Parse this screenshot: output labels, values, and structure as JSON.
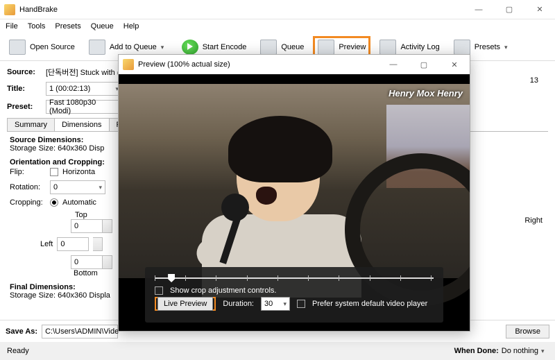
{
  "app": {
    "title": "HandBrake"
  },
  "menu": {
    "file": "File",
    "tools": "Tools",
    "presets": "Presets",
    "queue": "Queue",
    "help": "Help"
  },
  "toolbar": {
    "open": "Open Source",
    "add_queue": "Add to Queue",
    "start": "Start Encode",
    "queue": "Queue",
    "preview": "Preview",
    "activity": "Activity Log",
    "presets": "Presets"
  },
  "source": {
    "lbl": "Source:",
    "value": "[단독버전] Stuck with ("
  },
  "title_row": {
    "lbl": "Title:",
    "value": "1  (00:02:13)"
  },
  "right_labels": {
    "angle": "13"
  },
  "preset_row": {
    "lbl": "Preset:",
    "value": "Fast 1080p30  (Modi)"
  },
  "tabs": {
    "summary": "Summary",
    "dimensions": "Dimensions",
    "filter": "Filte"
  },
  "dim_panel": {
    "src_hdr": "Source Dimensions:",
    "src_storage": "Storage Size: 640x360      Disp",
    "orient_hdr": "Orientation and Cropping:",
    "flip_lbl": "Flip:",
    "flip_val": "Horizonta",
    "rot_lbl": "Rotation:",
    "rot_val": "0",
    "crop_lbl": "Cropping:",
    "crop_val": "Automatic",
    "top": "Top",
    "left": "Left",
    "bottom": "Bottom",
    "right": "Right",
    "zero": "0",
    "final_hdr": "Final Dimensions:",
    "final_storage": "Storage Size: 640x360      Displa"
  },
  "saveas": {
    "lbl": "Save As:",
    "value": "C:\\Users\\ADMIN\\Vide",
    "browse": "Browse"
  },
  "status": {
    "ready": "Ready",
    "when_lbl": "When Done:",
    "when_val": "Do nothing"
  },
  "preview": {
    "title": "Preview (100% actual size)",
    "watermark": "Henry Mox Henry",
    "crop_ctrl": "Show crop adjustment controls.",
    "live": "Live Preview",
    "dur_lbl": "Duration:",
    "dur_val": "30",
    "prefer": "Prefer system default video player"
  }
}
